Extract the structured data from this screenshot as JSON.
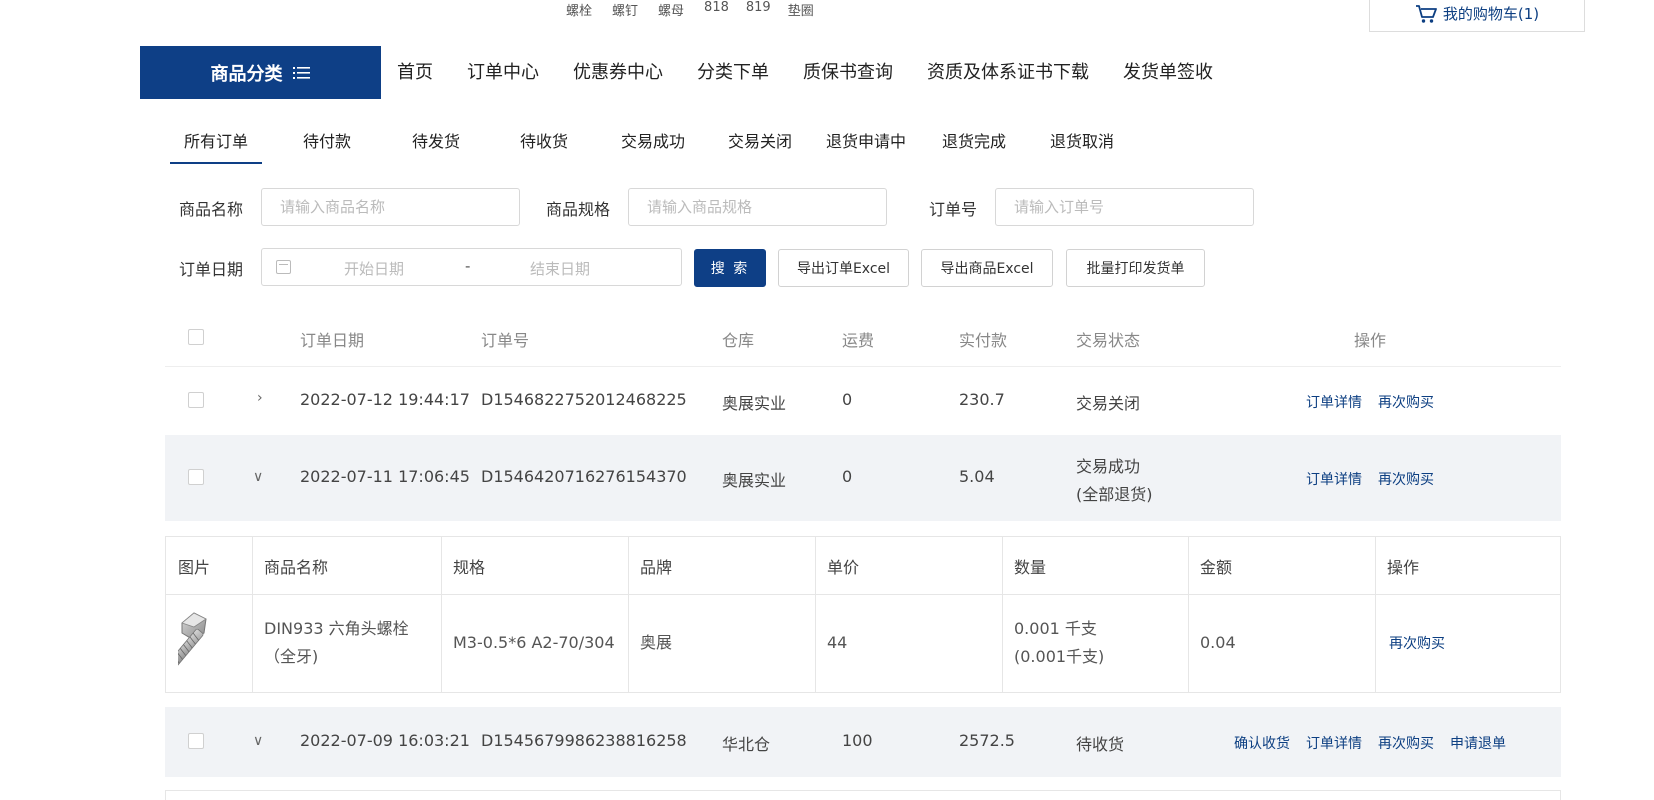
{
  "top_links": [
    "螺栓",
    "螺钉",
    "螺母",
    "818",
    "819",
    "垫圈"
  ],
  "cart": {
    "label": "我的购物车(1)"
  },
  "category": {
    "label": "商品分类"
  },
  "main_nav": [
    "首页",
    "订单中心",
    "优惠券中心",
    "分类下单",
    "质保书查询",
    "资质及体系证书下载",
    "发货单签收"
  ],
  "order_tabs": [
    "所有订单",
    "待付款",
    "待发货",
    "待收货",
    "交易成功",
    "交易关闭",
    "退货申请中",
    "退货完成",
    "退货取消"
  ],
  "active_tab": "所有订单",
  "filters": {
    "product_name_label": "商品名称",
    "product_name_placeholder": "请输入商品名称",
    "spec_label": "商品规格",
    "spec_placeholder": "请输入商品规格",
    "order_no_label": "订单号",
    "order_no_placeholder": "请输入订单号",
    "date_label": "订单日期",
    "start_placeholder": "开始日期",
    "date_sep": "-",
    "end_placeholder": "结束日期"
  },
  "buttons": {
    "search": "搜 索",
    "export_orders": "导出订单Excel",
    "export_products": "导出商品Excel",
    "batch_print": "批量打印发货单"
  },
  "table_headers": [
    "订单日期",
    "订单号",
    "仓库",
    "运费",
    "实付款",
    "交易状态",
    "操作"
  ],
  "orders": [
    {
      "date": "2022-07-12 19:44:17",
      "order_no": "D1546822752012468225",
      "warehouse": "奥展实业",
      "shipping": "0",
      "paid": "230.7",
      "status": "交易关闭",
      "status2": "",
      "actions": [
        "订单详情",
        "再次购买"
      ]
    },
    {
      "date": "2022-07-11 17:06:45",
      "order_no": "D1546420716276154370",
      "warehouse": "奥展实业",
      "shipping": "0",
      "paid": "5.04",
      "status": "交易成功",
      "status2": "(全部退货)",
      "actions": [
        "订单详情",
        "再次购买"
      ]
    },
    {
      "date": "2022-07-09 16:03:21",
      "order_no": "D1545679986238816258",
      "warehouse": "华北仓",
      "shipping": "100",
      "paid": "2572.5",
      "status": "待收货",
      "status2": "",
      "actions": [
        "确认收货",
        "订单详情",
        "再次购买",
        "申请退单"
      ]
    }
  ],
  "detail": {
    "headers": [
      "图片",
      "商品名称",
      "规格",
      "品牌",
      "单价",
      "数量",
      "金额",
      "操作"
    ],
    "item": {
      "name_line1": "DIN933 六角头螺栓",
      "name_line2": "（全牙)",
      "spec": "M3-0.5*6 A2-70/304",
      "brand": "奥展",
      "unit_price": "44",
      "qty_line1": "0.001 千支",
      "qty_line2": "(0.001千支)",
      "amount": "0.04",
      "action": "再次购买"
    }
  }
}
